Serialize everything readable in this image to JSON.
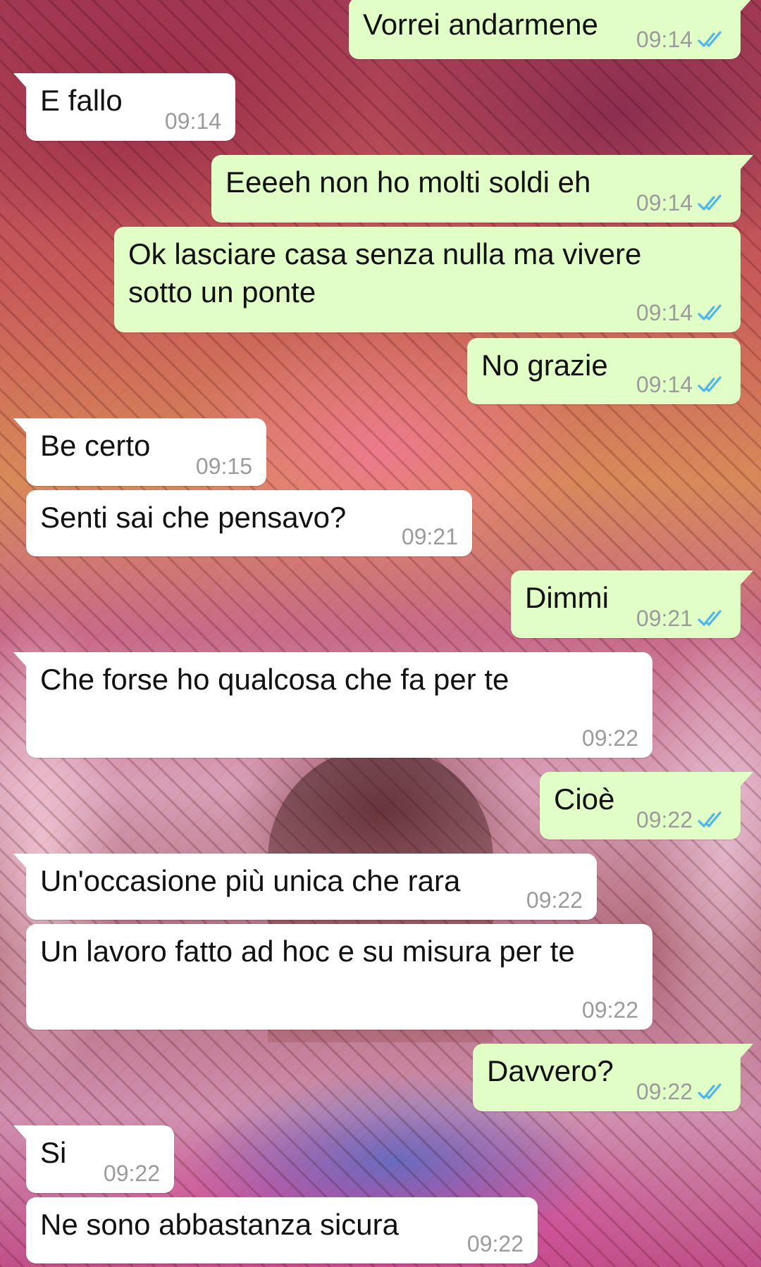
{
  "conversation": {
    "messages": [
      {
        "direction": "out",
        "text": "Vorrei andarmene",
        "time": "09:14",
        "status": "read"
      },
      {
        "direction": "in",
        "text": "E fallo",
        "time": "09:14"
      },
      {
        "direction": "out",
        "text": "Eeeeh non ho molti soldi eh",
        "time": "09:14",
        "status": "read"
      },
      {
        "direction": "out",
        "text": "Ok lasciare casa senza nulla ma vivere sotto un ponte",
        "time": "09:14",
        "status": "read"
      },
      {
        "direction": "out",
        "text": "No grazie",
        "time": "09:14",
        "status": "read"
      },
      {
        "direction": "in",
        "text": "Be certo",
        "time": "09:15"
      },
      {
        "direction": "in",
        "text": "Senti sai che pensavo?",
        "time": "09:21"
      },
      {
        "direction": "out",
        "text": "Dimmi",
        "time": "09:21",
        "status": "read"
      },
      {
        "direction": "in",
        "text": "Che forse ho qualcosa che fa per te",
        "time": "09:22"
      },
      {
        "direction": "out",
        "text": "Cioè",
        "time": "09:22",
        "status": "read"
      },
      {
        "direction": "in",
        "text": "Un'occasione più unica che rara",
        "time": "09:22"
      },
      {
        "direction": "in",
        "text": "Un lavoro fatto ad hoc e su misura per te",
        "time": "09:22"
      },
      {
        "direction": "out",
        "text": "Davvero?",
        "time": "09:22",
        "status": "read"
      },
      {
        "direction": "in",
        "text": "Si",
        "time": "09:22"
      },
      {
        "direction": "in",
        "text": "Ne sono abbastanza sicura",
        "time": "09:22"
      }
    ]
  },
  "colors": {
    "incoming_bubble": "#ffffff",
    "outgoing_bubble": "#e1fec6",
    "timestamp": "#9b9b9b",
    "read_ticks": "#4fb6ec"
  },
  "icons": {
    "read_receipt": "double-check-icon"
  }
}
